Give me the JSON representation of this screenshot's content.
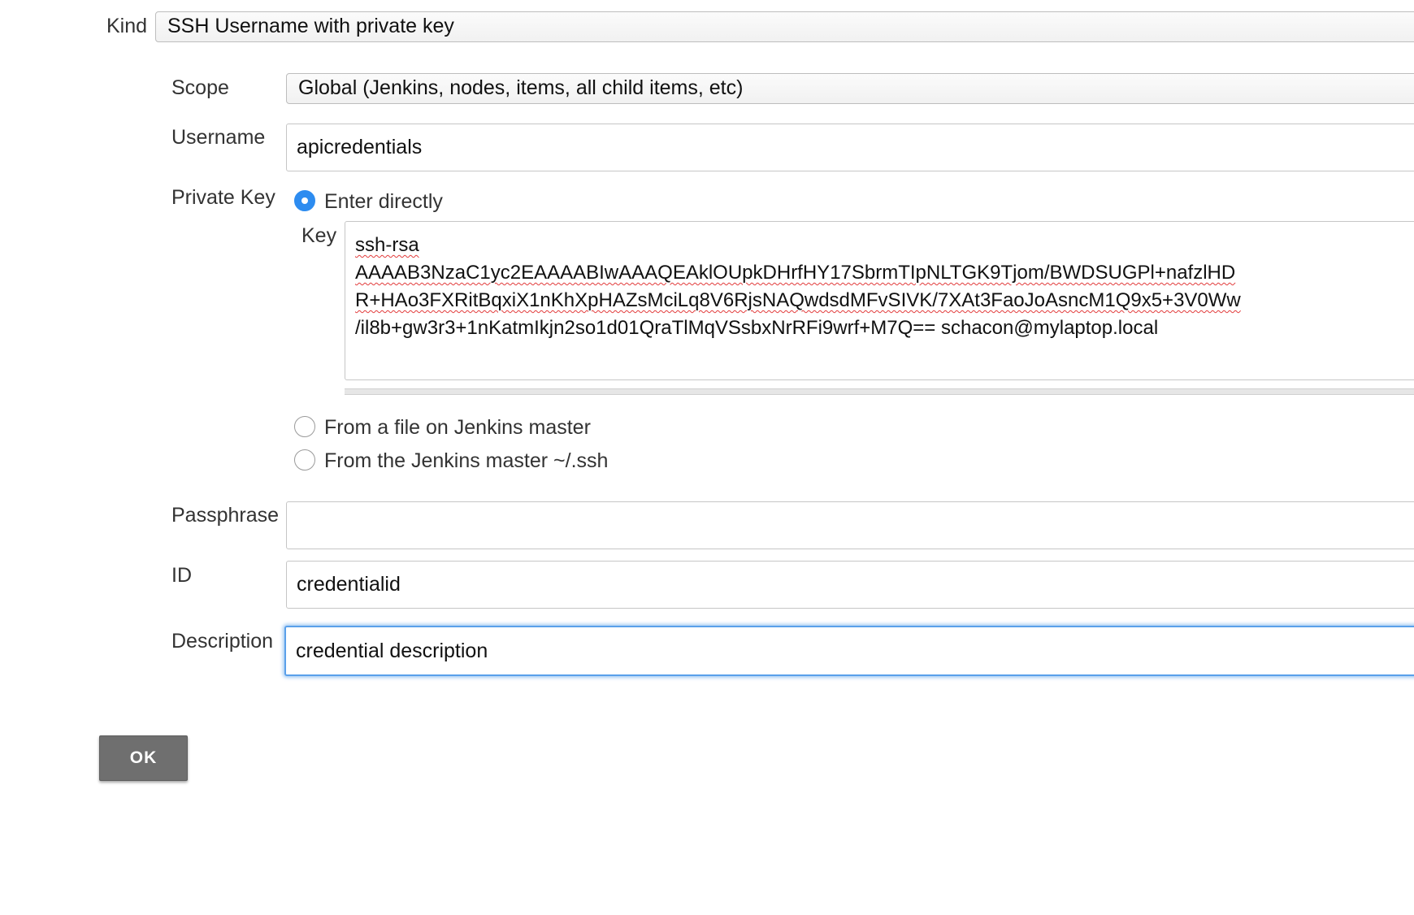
{
  "kind": {
    "label": "Kind",
    "selected": "SSH Username with private key"
  },
  "scope": {
    "label": "Scope",
    "selected": "Global (Jenkins, nodes, items, all child items, etc)"
  },
  "username": {
    "label": "Username",
    "value": "apicredentials"
  },
  "private_key": {
    "label": "Private Key",
    "options": [
      {
        "label": "Enter directly",
        "checked": true
      },
      {
        "label": "From a file on Jenkins master",
        "checked": false
      },
      {
        "label": "From the Jenkins master ~/.ssh",
        "checked": false
      }
    ],
    "key_label": "Key",
    "key_lines": [
      "ssh-rsa",
      "AAAAB3NzaC1yc2EAAAABIwAAAQEAklOUpkDHrfHY17SbrmTIpNLTGK9Tjom/BWDSUGPl+nafzlHD",
      "R+HAo3FXRitBqxiX1nKhXpHAZsMciLq8V6RjsNAQwdsdMFvSIVK/7XAt3FaoJoAsncM1Q9x5+3V0Ww",
      "/il8b+gw3r3+1nKatmIkjn2so1d01QraTlMqVSsbxNrRFi9wrf+M7Q== schacon@mylaptop.local"
    ]
  },
  "passphrase": {
    "label": "Passphrase",
    "value": ""
  },
  "id_field": {
    "label": "ID",
    "value": "credentialid"
  },
  "description": {
    "label": "Description",
    "value": "credential description"
  },
  "ok_button": {
    "label": "OK"
  },
  "colors": {
    "accent": "#2d8cf0",
    "focus": "#5aa0ea",
    "button_bg": "#6f6f6f"
  }
}
